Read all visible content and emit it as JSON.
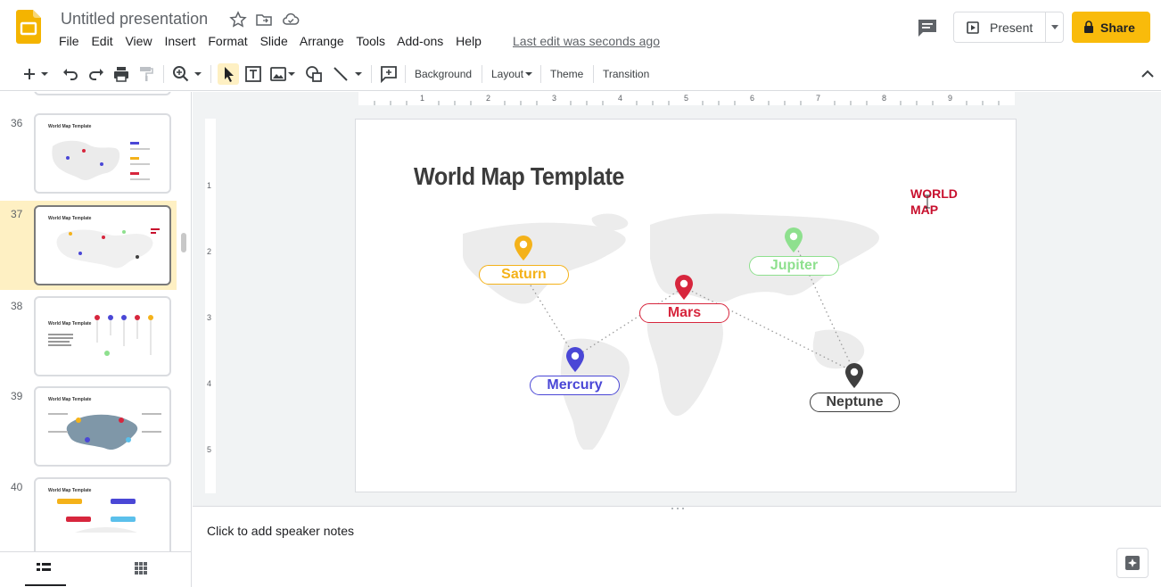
{
  "app": {
    "title": "Untitled presentation",
    "last_edit": "Last edit was seconds ago",
    "present_label": "Present",
    "share_label": "Share"
  },
  "menu": [
    "File",
    "Edit",
    "View",
    "Insert",
    "Format",
    "Slide",
    "Arrange",
    "Tools",
    "Add-ons",
    "Help"
  ],
  "toolbar": {
    "background_label": "Background",
    "layout_label": "Layout",
    "theme_label": "Theme",
    "transition_label": "Transition"
  },
  "ruler": {
    "horizontal": [
      "1",
      "2",
      "3",
      "4",
      "5",
      "6",
      "7",
      "8",
      "9"
    ],
    "vertical": [
      "1",
      "2",
      "3",
      "4",
      "5"
    ]
  },
  "filmstrip": {
    "slides": [
      {
        "number": "36",
        "title": "World Map Template"
      },
      {
        "number": "37",
        "title": "World Map Template"
      },
      {
        "number": "38",
        "title": "World Map Template"
      },
      {
        "number": "39",
        "title": "World Map Template"
      },
      {
        "number": "40",
        "title": "World Map Template"
      }
    ]
  },
  "slide": {
    "title": "World Map Template",
    "label": "WORLD MAP",
    "pins": [
      {
        "name": "Saturn",
        "color": "#f4b21a"
      },
      {
        "name": "Jupiter",
        "color": "#8ee08e"
      },
      {
        "name": "Mars",
        "color": "#d7263d"
      },
      {
        "name": "Mercury",
        "color": "#4a47d6"
      },
      {
        "name": "Neptune",
        "color": "#3f3f3f"
      }
    ]
  },
  "notes": {
    "placeholder": "Click to add speaker notes"
  },
  "colors": {
    "accent": "#f9bb0b",
    "selection": "#fef0c3"
  }
}
